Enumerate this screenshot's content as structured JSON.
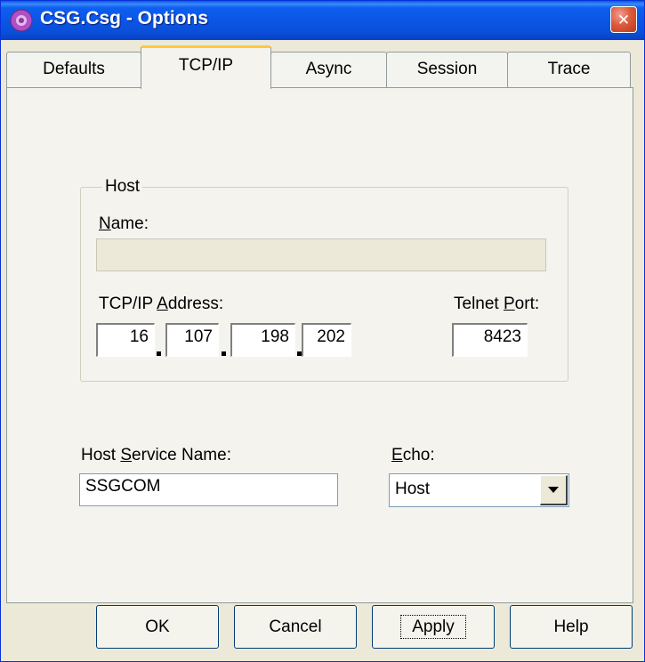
{
  "window": {
    "title": "CSG.Csg - Options",
    "close_glyph": "✕"
  },
  "tabs": [
    {
      "label": "Defaults",
      "active": false
    },
    {
      "label": "TCP/IP",
      "active": true
    },
    {
      "label": "Async",
      "active": false
    },
    {
      "label": "Session",
      "active": false
    },
    {
      "label": "Trace",
      "active": false
    }
  ],
  "host_group": {
    "label": "Host",
    "name_label_u": "N",
    "name_label_rest": "ame:",
    "name_value": "",
    "tcpip_label_pre": "TCP/IP ",
    "tcpip_label_u": "A",
    "tcpip_label_rest": "ddress:",
    "ip_octets": [
      "16",
      "107",
      "198",
      "202"
    ],
    "telnet_label_pre": "Telnet ",
    "telnet_label_u": "P",
    "telnet_label_rest": "ort:",
    "telnet_port": "8423"
  },
  "host_service": {
    "label_pre": "Host ",
    "label_u": "S",
    "label_rest": "ervice Name:",
    "value": "SSGCOM"
  },
  "echo": {
    "label_u": "E",
    "label_rest": "cho:",
    "selected": "Host"
  },
  "buttons": {
    "ok": "OK",
    "cancel": "Cancel",
    "apply": "Apply",
    "help": "Help"
  },
  "colors": {
    "titlebar": "#0A56E6",
    "dialog_bg": "#ECE9D8",
    "tab_highlight": "#FFC83C",
    "close_button": "#DE5A3C"
  }
}
